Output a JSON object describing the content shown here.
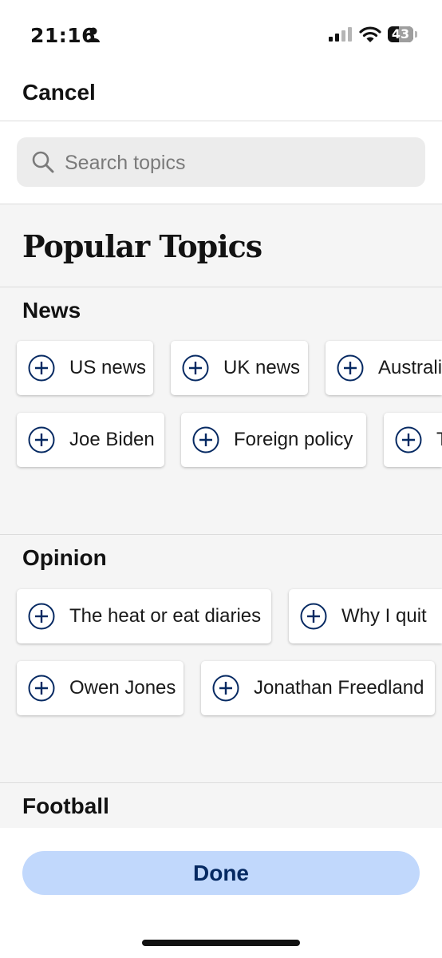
{
  "status": {
    "time": "21:16",
    "battery": "43"
  },
  "nav": {
    "cancel_label": "Cancel"
  },
  "search": {
    "placeholder": "Search topics",
    "value": ""
  },
  "popular_title": "Popular Topics",
  "sections": {
    "news": {
      "title": "News",
      "chips": [
        "US news",
        "UK news",
        "Australia news",
        "Joe Biden",
        "Foreign policy",
        "T"
      ]
    },
    "opinion": {
      "title": "Opinion",
      "chips": [
        "The heat or eat diaries",
        "Why I quit",
        "Owen Jones",
        "Jonathan Freedland"
      ]
    },
    "football": {
      "title": "Football"
    }
  },
  "footer": {
    "done_label": "Done"
  },
  "colors": {
    "accent": "#052962",
    "done_bg": "#c1d8fc",
    "chip_bg": "#ffffff",
    "page_bg": "#f5f5f5"
  },
  "icons": [
    "person-icon",
    "signal-icon",
    "wifi-icon",
    "battery-icon",
    "search-icon",
    "plus-circle-icon"
  ]
}
